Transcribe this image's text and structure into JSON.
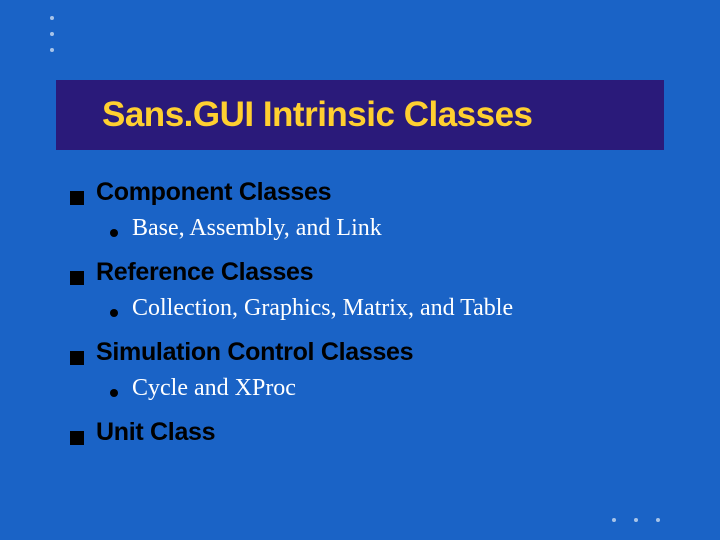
{
  "title": "Sans.GUI Intrinsic Classes",
  "sections": [
    {
      "heading": "Component Classes",
      "sub": "Base, Assembly, and Link"
    },
    {
      "heading": "Reference Classes",
      "sub": "Collection, Graphics, Matrix, and Table"
    },
    {
      "heading": "Simulation Control Classes",
      "sub": "Cycle and XProc"
    },
    {
      "heading": "Unit Class",
      "sub": null
    }
  ]
}
